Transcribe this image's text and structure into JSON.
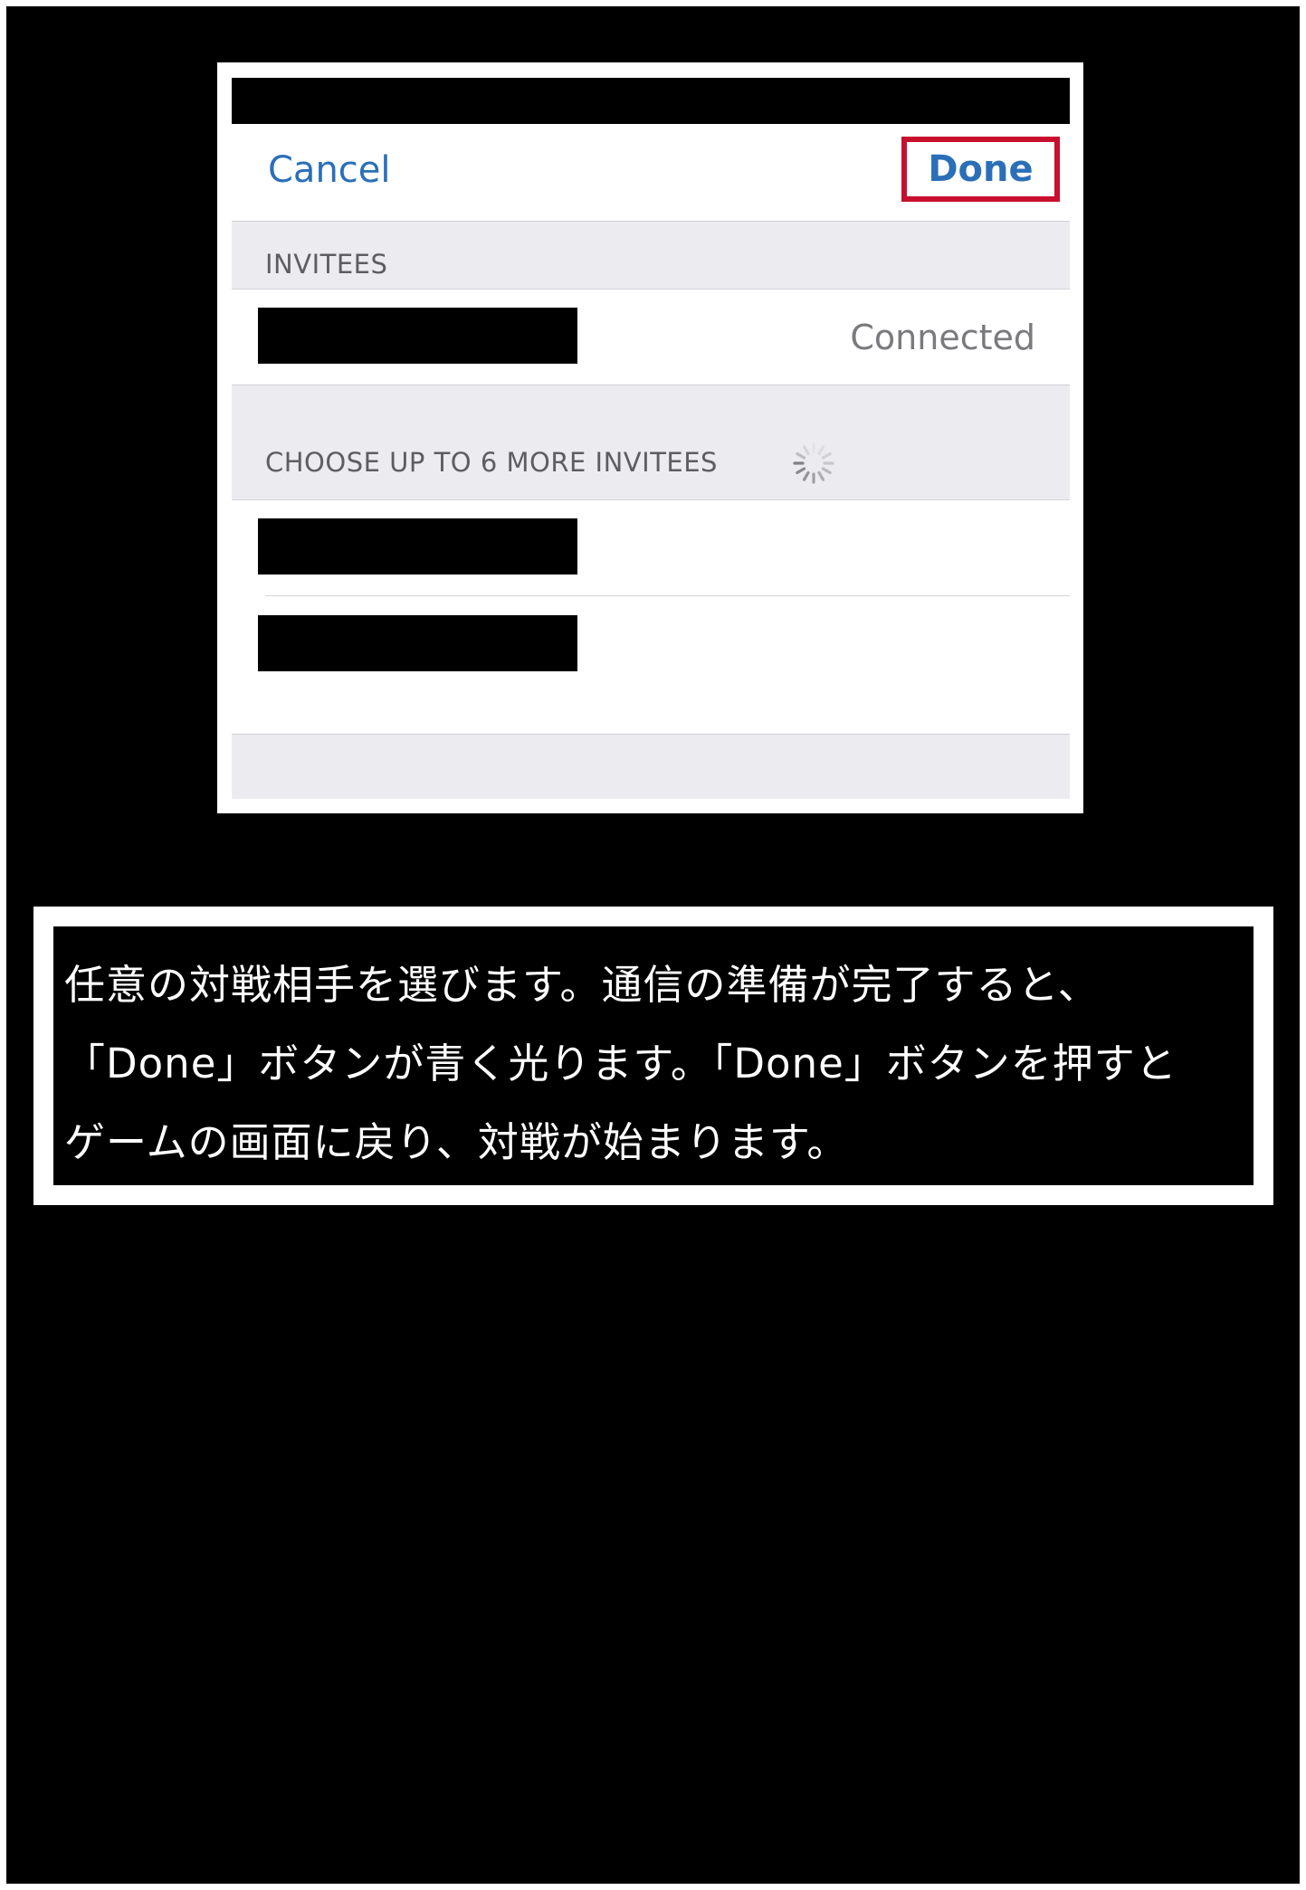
{
  "dialog": {
    "cancel_label": "Cancel",
    "done_label": "Done",
    "invitees_header": "INVITEES",
    "invitees": [
      {
        "status": "Connected"
      }
    ],
    "more_header": "CHOOSE UP TO 6 MORE INVITEES",
    "more_invitees_count": 2,
    "highlight_color": "#c8102e",
    "accent_color": "#2a6fb8"
  },
  "caption": {
    "lines": [
      "任意の対戦相手を選びます。通信の準備が完了すると、",
      "「Done」ボタンが青く光ります。「Done」ボタンを押すと",
      "ゲームの画面に戻り、対戦が始まります。"
    ]
  }
}
